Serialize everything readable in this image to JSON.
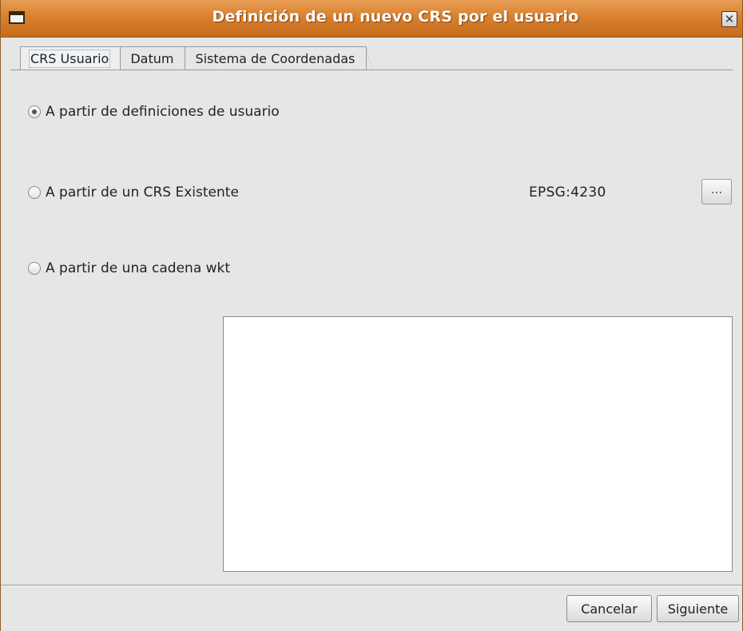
{
  "window": {
    "title": "Definición de un nuevo CRS por el usuario",
    "close_glyph": "✕"
  },
  "tabs": [
    {
      "label": "CRS Usuario",
      "active": true
    },
    {
      "label": "Datum",
      "active": false
    },
    {
      "label": "Sistema de Coordenadas",
      "active": false
    }
  ],
  "options": {
    "user_definitions": {
      "label": "A partir de definiciones de usuario",
      "checked": true
    },
    "existing_crs": {
      "label": "A partir de un CRS Existente",
      "checked": false
    },
    "wkt_string": {
      "label": "A partir de una cadena wkt",
      "checked": false
    }
  },
  "existing_crs_code": "EPSG:4230",
  "browse_label": "...",
  "wkt_text": "",
  "buttons": {
    "cancel": "Cancelar",
    "next": "Siguiente"
  }
}
